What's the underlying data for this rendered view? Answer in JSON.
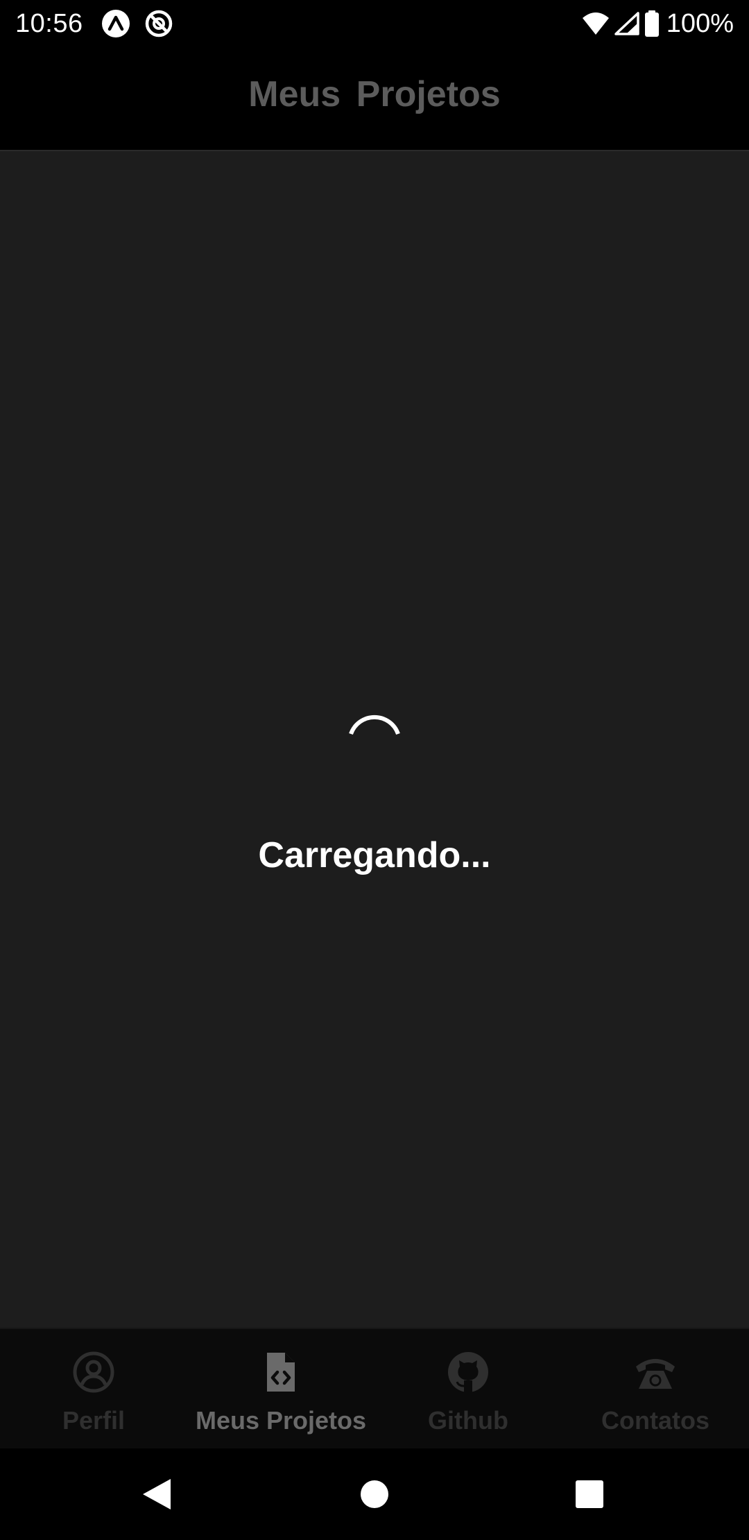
{
  "status_bar": {
    "time": "10:56",
    "battery": "100%",
    "icons": [
      "app-notification-icon-1",
      "app-notification-icon-2",
      "wifi-icon",
      "cellular-signal-icon",
      "battery-icon"
    ]
  },
  "header": {
    "title": "Meus  Projetos"
  },
  "content": {
    "loading_text": "Carregando..."
  },
  "tab_bar": {
    "tabs": [
      {
        "label": "Perfil",
        "icon": "user-circle-icon",
        "active": false
      },
      {
        "label": "Meus Projetos",
        "icon": "code-file-icon",
        "active": true
      },
      {
        "label": "Github",
        "icon": "github-icon",
        "active": false
      },
      {
        "label": "Contatos",
        "icon": "telephone-icon",
        "active": false
      }
    ]
  },
  "nav_bar": {
    "buttons": [
      "back-icon",
      "home-icon",
      "recents-icon"
    ]
  },
  "colors": {
    "header_background": "#000000",
    "content_background": "#1d1d1d",
    "tab_bar_background": "#0b0b0b",
    "header_title": "#5c5c5c",
    "tab_active": "#6a6a6a",
    "tab_inactive": "#2f2f2f",
    "loading_text": "#ffffff"
  }
}
